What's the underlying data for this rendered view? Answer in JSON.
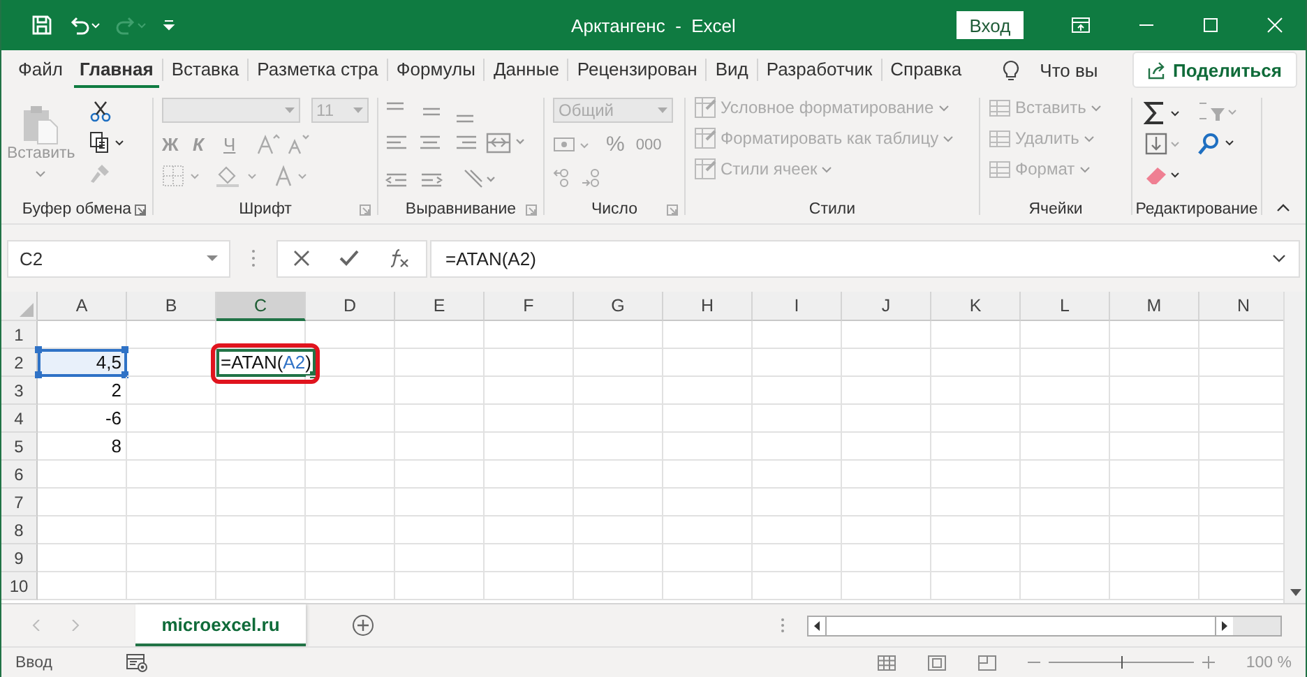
{
  "title_bar": {
    "title": "Арктангенс  -  Excel",
    "sign_in": "Вход",
    "redo_disabled": true
  },
  "ribbon_tabs": [
    {
      "label": "Файл",
      "selected": false
    },
    {
      "label": "Главная",
      "selected": true
    },
    {
      "label": "Вставка",
      "selected": false
    },
    {
      "label": "Разметка стра",
      "selected": false
    },
    {
      "label": "Формулы",
      "selected": false
    },
    {
      "label": "Данные",
      "selected": false
    },
    {
      "label": "Рецензирован",
      "selected": false
    },
    {
      "label": "Вид",
      "selected": false
    },
    {
      "label": "Разработчик",
      "selected": false
    },
    {
      "label": "Справка",
      "selected": false
    }
  ],
  "tell_me": "Что вы",
  "share": "Поделиться",
  "ribbon": {
    "clipboard": {
      "label": "Буфер обмена",
      "paste": "Вставить"
    },
    "font": {
      "label": "Шрифт",
      "size": "11",
      "bold": "Ж",
      "italic": "К",
      "underline": "Ч"
    },
    "alignment": {
      "label": "Выравнивание"
    },
    "number": {
      "label": "Число",
      "format": "Общий",
      "percent": "%",
      "thousands": "000"
    },
    "styles": {
      "label": "Стили",
      "items": [
        "Условное форматирование",
        "Форматировать как таблицу",
        "Стили ячеек"
      ]
    },
    "cells": {
      "label": "Ячейки",
      "items": [
        "Вставить",
        "Удалить",
        "Формат"
      ]
    },
    "editing": {
      "label": "Редактирование"
    }
  },
  "formula_bar": {
    "name_box": "C2",
    "formula": "=ATAN(A2)"
  },
  "grid": {
    "columns": [
      {
        "label": "A",
        "selected": false
      },
      {
        "label": "B",
        "selected": false
      },
      {
        "label": "C",
        "selected": true
      },
      {
        "label": "D",
        "selected": false
      },
      {
        "label": "E",
        "selected": false
      },
      {
        "label": "F",
        "selected": false
      },
      {
        "label": "G",
        "selected": false
      },
      {
        "label": "H",
        "selected": false
      },
      {
        "label": "I",
        "selected": false
      },
      {
        "label": "J",
        "selected": false
      },
      {
        "label": "K",
        "selected": false
      },
      {
        "label": "L",
        "selected": false
      },
      {
        "label": "M",
        "selected": false
      },
      {
        "label": "N",
        "selected": false
      }
    ],
    "rows": [
      {
        "label": "1"
      },
      {
        "label": "2",
        "cells": [
          {
            "kind": "value",
            "value": "4,5",
            "referenced": true
          },
          "",
          {
            "kind": "editing",
            "highlighted": true,
            "parts": [
              {
                "text": "=ATAN(",
                "ref": false
              },
              {
                "text": "A2",
                "ref": true
              },
              {
                "text": ")",
                "ref": false
              }
            ]
          }
        ]
      },
      {
        "label": "3",
        "cells": [
          {
            "kind": "value",
            "value": "2",
            "referenced": false
          }
        ]
      },
      {
        "label": "4",
        "cells": [
          {
            "kind": "value",
            "value": "-6",
            "referenced": false
          }
        ]
      },
      {
        "label": "5",
        "cells": [
          {
            "kind": "value",
            "value": "8",
            "referenced": false
          }
        ]
      },
      {
        "label": "6"
      },
      {
        "label": "7"
      },
      {
        "label": "8"
      },
      {
        "label": "9"
      },
      {
        "label": "10"
      }
    ]
  },
  "sheet_tabs": [
    {
      "label": "microexcel.ru",
      "selected": true
    }
  ],
  "status_bar": {
    "mode": "Ввод",
    "zoom": "100 %",
    "zoom_slider": {
      "level": 0.5
    }
  }
}
